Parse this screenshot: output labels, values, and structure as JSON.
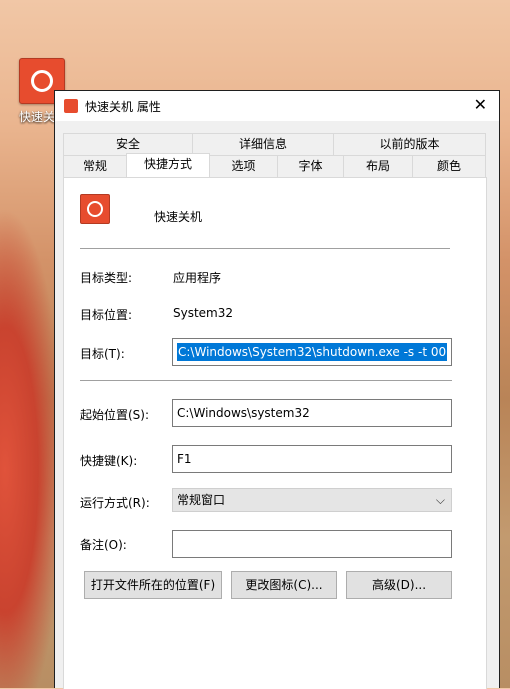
{
  "desktop": {
    "icon_label": "快速关"
  },
  "window": {
    "title": "快速关机 属性",
    "close_glyph": "✕"
  },
  "tabs_top": [
    "安全",
    "详细信息",
    "以前的版本"
  ],
  "tabs_bottom": [
    "常规",
    "快捷方式",
    "选项",
    "字体",
    "布局",
    "颜色"
  ],
  "active_tab": "快捷方式",
  "shortcut": {
    "name": "快速关机",
    "target_type_label": "目标类型:",
    "target_type_value": "应用程序",
    "target_location_label": "目标位置:",
    "target_location_value": "System32",
    "target_label": "目标(T):",
    "target_value": "C:\\Windows\\System32\\shutdown.exe -s -t 00",
    "start_in_label": "起始位置(S):",
    "start_in_value": "C:\\Windows\\system32",
    "hotkey_label": "快捷键(K):",
    "hotkey_value": "F1",
    "run_label": "运行方式(R):",
    "run_value": "常规窗口",
    "comment_label": "备注(O):",
    "comment_value": ""
  },
  "buttons": {
    "open_location": "打开文件所在的位置(F)",
    "change_icon": "更改图标(C)...",
    "advanced": "高级(D)..."
  },
  "colors": {
    "accent_icon": "#e74c2e",
    "selection": "#0078d7"
  }
}
